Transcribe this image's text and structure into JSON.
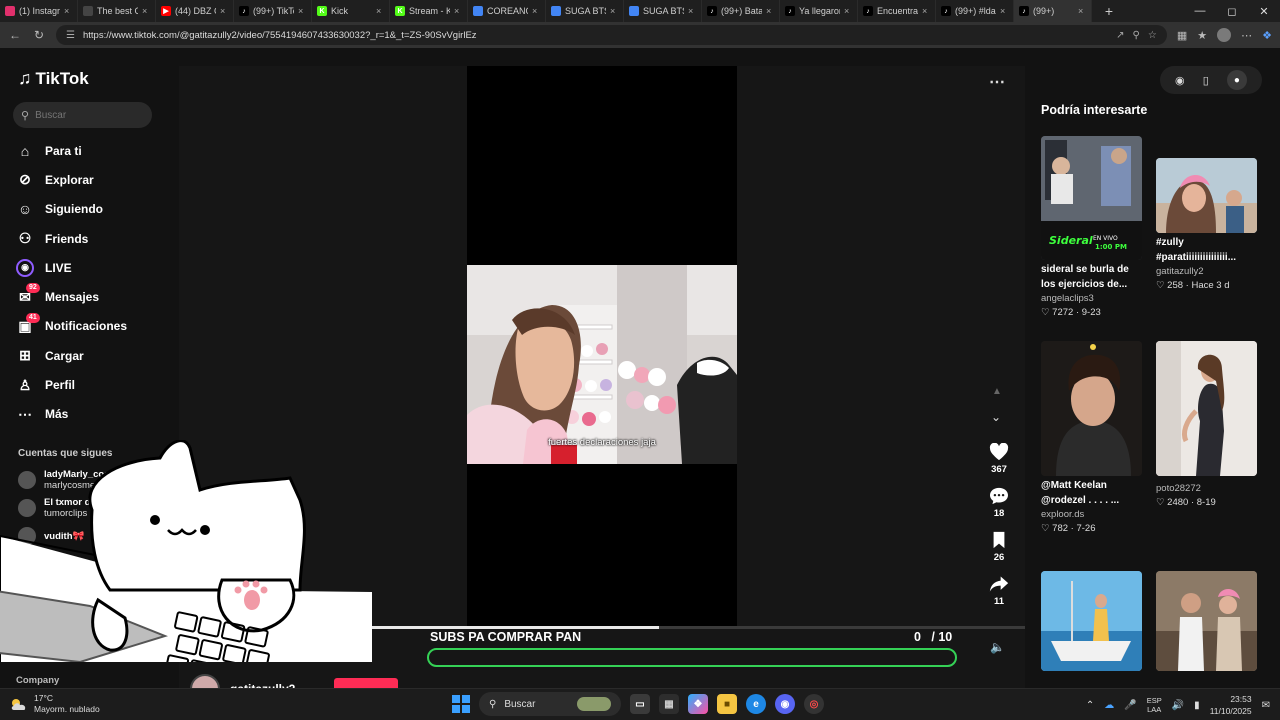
{
  "browser": {
    "tabs": [
      {
        "label": "(1) Instagram",
        "icon": "instagram-icon",
        "color": "#e1306c"
      },
      {
        "label": "The best C",
        "icon": "generic-site-icon",
        "color": "#444444"
      },
      {
        "label": "(44) DBZ C",
        "icon": "youtube-icon",
        "color": "#ff0000"
      },
      {
        "label": "(99+) TikTo",
        "icon": "tiktok-icon",
        "color": "#000000"
      },
      {
        "label": "Kick",
        "icon": "kick-icon",
        "color": "#53fc18"
      },
      {
        "label": "Stream - K",
        "icon": "kick-icon",
        "color": "#53fc18"
      },
      {
        "label": "COREANO",
        "icon": "search-icon",
        "color": "#4285f4"
      },
      {
        "label": "SUGA BTS",
        "icon": "search-icon",
        "color": "#4285f4"
      },
      {
        "label": "SUGA BTS",
        "icon": "search-icon",
        "color": "#4285f4"
      },
      {
        "label": "(99+) Batal",
        "icon": "tiktok-icon",
        "color": "#000000"
      },
      {
        "label": "Ya llegaron",
        "icon": "tiktok-icon",
        "color": "#000000"
      },
      {
        "label": "Encuentra",
        "icon": "tiktok-icon",
        "color": "#000000"
      },
      {
        "label": "(99+) #lda",
        "icon": "tiktok-icon",
        "color": "#000000"
      },
      {
        "label": "(99+)",
        "icon": "tiktok-icon",
        "color": "#000000",
        "active": true
      }
    ],
    "url": "https://www.tiktok.com/@gatitazully2/video/7554194607433630032?_r=1&_t=ZS-90SvVgirlEz"
  },
  "sidebar": {
    "logo": "TikTok",
    "search_placeholder": "Buscar",
    "nav": [
      {
        "label": "Para ti",
        "icon": "home-icon"
      },
      {
        "label": "Explorar",
        "icon": "compass-icon"
      },
      {
        "label": "Siguiendo",
        "icon": "following-icon"
      },
      {
        "label": "Friends",
        "icon": "friends-icon"
      },
      {
        "label": "LIVE",
        "icon": "live-icon"
      },
      {
        "label": "Mensajes",
        "icon": "messages-icon",
        "badge": "92"
      },
      {
        "label": "Notificaciones",
        "icon": "notifications-icon",
        "badge": "41"
      },
      {
        "label": "Cargar",
        "icon": "upload-icon"
      },
      {
        "label": "Perfil",
        "icon": "profile-icon"
      },
      {
        "label": "Más",
        "icon": "more-icon"
      }
    ],
    "following_title": "Cuentas que sigues",
    "following": [
      {
        "name": "ladyMarly_cosme...",
        "handle": "marlycosmetic_ofici"
      },
      {
        "name": "El txmor de M",
        "handle": "tumorclips"
      },
      {
        "name": "vudith🎀",
        "handle": ""
      }
    ],
    "company": "Company"
  },
  "video": {
    "caption": "fuertes declaraciones jaja",
    "likes": "367",
    "comments": "18",
    "saves": "26",
    "shares": "11",
    "progress": 0.44,
    "author": "gatitazully2"
  },
  "stream_overlay": {
    "goal_title": "SUBS PA COMPRAR PAN",
    "goal_current": "0",
    "goal_total": "/ 10",
    "goal_fraction": 0.0,
    "goal_color": "#35d156"
  },
  "right": {
    "title": "Podría interesarte",
    "cards": [
      {
        "desc1": "sideral se burla de",
        "desc2": "los ejercicios de...",
        "author": "angelaclips3",
        "likes": "7272",
        "date": "9-23"
      },
      {
        "desc1": "#zully",
        "desc2": "#paratiiiiiiiiiiiiiii...",
        "author": "gatitazully2",
        "likes": "258",
        "date": "Hace 3 d"
      },
      {
        "desc1": "@Matt Keelan",
        "desc2": "@rodezel . . . . ...",
        "author": "exploor.ds",
        "likes": "782",
        "date": "7-26"
      },
      {
        "desc1": "",
        "desc2": "",
        "author": "poto28272",
        "likes": "2480",
        "date": "8-19"
      }
    ]
  },
  "taskbar": {
    "temp": "17°C",
    "weather": "Mayorm. nublado",
    "search": "Buscar",
    "lang1": "ESP",
    "lang2": "LAA",
    "time": "23:53",
    "date": "11/10/2025"
  },
  "colors": {
    "tiktok_red": "#fe2c55",
    "goal_green": "#35d156"
  }
}
